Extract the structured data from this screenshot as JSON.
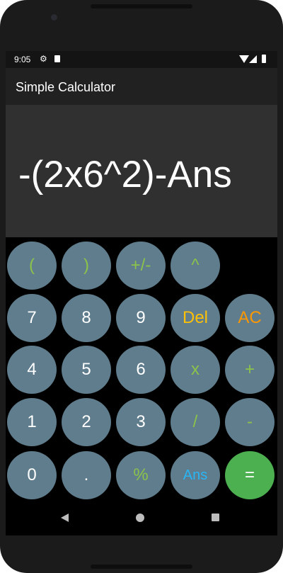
{
  "status": {
    "time": "9:05"
  },
  "app": {
    "title": "Simple Calculator"
  },
  "display": {
    "expression": "-(2x6^2)-Ans"
  },
  "keys": {
    "open_paren": "(",
    "close_paren": ")",
    "plus_minus": "+/-",
    "power": "^",
    "seven": "7",
    "eight": "8",
    "nine": "9",
    "delete": "Del",
    "clear": "AC",
    "four": "4",
    "five": "5",
    "six": "6",
    "multiply": "x",
    "add": "+",
    "one": "1",
    "two": "2",
    "three": "3",
    "divide": "/",
    "subtract": "-",
    "zero": "0",
    "decimal": ".",
    "percent": "%",
    "answer": "Ans",
    "equals": "="
  },
  "colors": {
    "key_background": "#5f7d8d",
    "operator_text": "#8bc34a",
    "delete_text": "#ffc107",
    "clear_text": "#ff9800",
    "answer_text": "#29b6f6",
    "equals_background": "#4caf50"
  }
}
